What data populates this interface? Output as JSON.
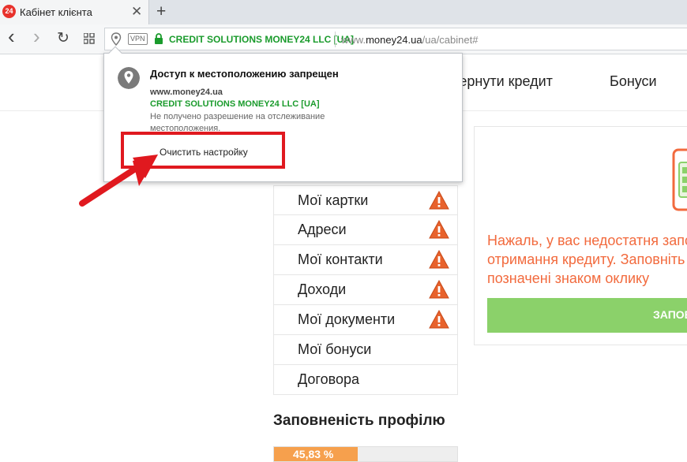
{
  "tab": {
    "favicon_text": "24",
    "title": "Кабінет клієнта",
    "close_glyph": "✕",
    "new_tab_glyph": "+"
  },
  "toolbar": {
    "back_glyph": "‹",
    "forward_glyph": "›",
    "reload_glyph": "↻",
    "vpn_label": "VPN",
    "site_name": "CREDIT SOLUTIONS MONEY24 LLC [UA]",
    "url_prefix": "www.",
    "url_domain": "money24.ua",
    "url_path": "/ua/cabinet#"
  },
  "header_nav": [
    "вернути кредит",
    "Бонуси"
  ],
  "popup": {
    "title": "Доступ к местоположению запрещен",
    "host": "www.money24.ua",
    "org": "CREDIT SOLUTIONS MONEY24 LLC [UA]",
    "description": "Не получено разрешение на отслеживание местоположения.",
    "button": "Очистить настройку"
  },
  "menu": [
    {
      "label": "Мої картки",
      "warning": true
    },
    {
      "label": "Адреси",
      "warning": true
    },
    {
      "label": "Мої контакти",
      "warning": true
    },
    {
      "label": "Доходи",
      "warning": true
    },
    {
      "label": "Мої документи",
      "warning": true
    },
    {
      "label": "Мої бонуси",
      "warning": false
    },
    {
      "label": "Договора",
      "warning": false
    }
  ],
  "profile": {
    "title": "Заповненість профілю",
    "percent_label": "45,83 %",
    "percent": 45.83
  },
  "card": {
    "text_lines": [
      "Нажаль, у вас недостатня запо",
      "отримання кредиту. Заповніть",
      "позначені знаком оклику"
    ],
    "button": "ЗАПОВ"
  },
  "colors": {
    "accent_orange": "#f26a3d",
    "warning_orange": "#e8622c",
    "green_button": "#8bd16a",
    "secure_green": "#1a9b2c",
    "highlight_red": "#e0191f"
  }
}
